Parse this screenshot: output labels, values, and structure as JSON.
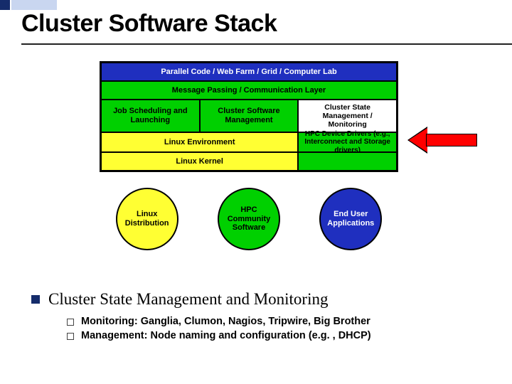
{
  "title": "Cluster Software Stack",
  "stack": {
    "r1": "Parallel Code / Web Farm / Grid / Computer Lab",
    "r2": "Message Passing / Communication Layer",
    "r3": {
      "c1": "Job Scheduling and Launching",
      "c2": "Cluster Software Management",
      "c3": "Cluster State Management / Monitoring"
    },
    "r4": {
      "c1": "Linux Environment",
      "c2": "HPC Device Drivers (e.g., Interconnect and Storage drivers)"
    },
    "r5": {
      "c1": "Linux Kernel",
      "c2": ""
    }
  },
  "circles": {
    "c1": "Linux Distribution",
    "c2": "HPC Community Software",
    "c3": "End User Applications"
  },
  "bullet": "Cluster State Management and Monitoring",
  "sub": {
    "s1": "Monitoring: Ganglia, Clumon, Nagios, Tripwire, Big Brother",
    "s2": "Management: Node naming and configuration (e.g. , DHCP)"
  }
}
